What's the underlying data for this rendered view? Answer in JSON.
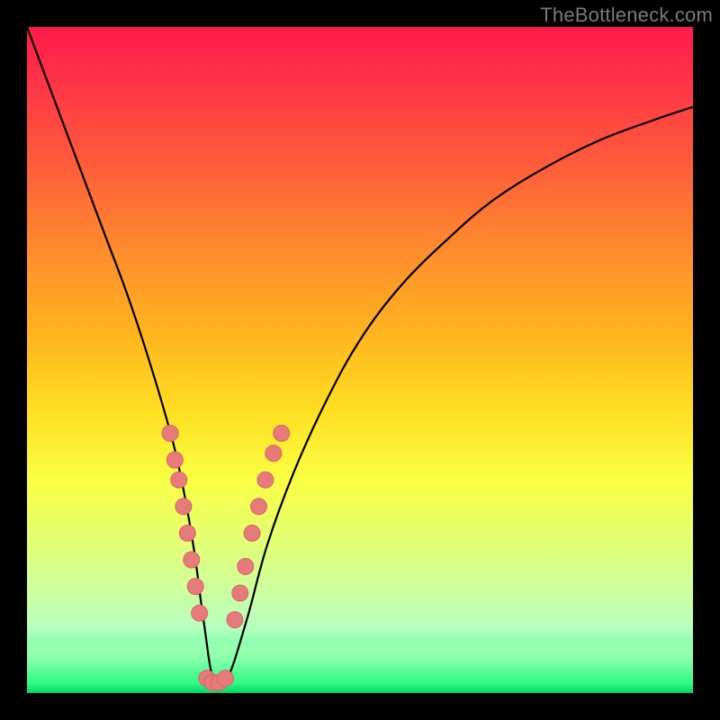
{
  "watermark": {
    "text": "TheBottleneck.com"
  },
  "colors": {
    "curve_stroke": "#000000",
    "marker_fill": "#e77a7a",
    "marker_stroke": "#d86666",
    "background": "#000000"
  },
  "chart_data": {
    "type": "line",
    "title": "",
    "xlabel": "",
    "ylabel": "",
    "xlim": [
      0,
      100
    ],
    "ylim": [
      0,
      100
    ],
    "grid": false,
    "legend": false,
    "series": [
      {
        "name": "curve",
        "x": [
          0,
          3,
          6,
          9,
          12,
          15,
          18,
          21,
          23,
          25,
          26.5,
          28,
          30,
          33,
          36,
          40,
          45,
          50,
          56,
          63,
          70,
          78,
          86,
          94,
          100
        ],
        "y": [
          100,
          92,
          84,
          76,
          68,
          60,
          51,
          41,
          33,
          22,
          11,
          2,
          2,
          11,
          22,
          33,
          44,
          53,
          61,
          68,
          74,
          79,
          83,
          86,
          88
        ]
      }
    ],
    "markers": [
      {
        "name": "left-descending",
        "points": [
          {
            "x": 21.5,
            "y": 39
          },
          {
            "x": 22.2,
            "y": 35
          },
          {
            "x": 22.8,
            "y": 32
          },
          {
            "x": 23.5,
            "y": 28
          },
          {
            "x": 24.1,
            "y": 24
          },
          {
            "x": 24.7,
            "y": 20
          },
          {
            "x": 25.3,
            "y": 16
          },
          {
            "x": 25.9,
            "y": 12
          }
        ]
      },
      {
        "name": "valley-floor",
        "points": [
          {
            "x": 27.0,
            "y": 2.2
          },
          {
            "x": 27.8,
            "y": 1.6
          },
          {
            "x": 28.8,
            "y": 1.6
          },
          {
            "x": 29.8,
            "y": 2.2
          }
        ]
      },
      {
        "name": "right-ascending",
        "points": [
          {
            "x": 31.2,
            "y": 11
          },
          {
            "x": 32.0,
            "y": 15
          },
          {
            "x": 32.8,
            "y": 19
          },
          {
            "x": 33.8,
            "y": 24
          },
          {
            "x": 34.8,
            "y": 28
          },
          {
            "x": 35.8,
            "y": 32
          },
          {
            "x": 37.0,
            "y": 36
          },
          {
            "x": 38.2,
            "y": 39
          }
        ]
      }
    ]
  }
}
